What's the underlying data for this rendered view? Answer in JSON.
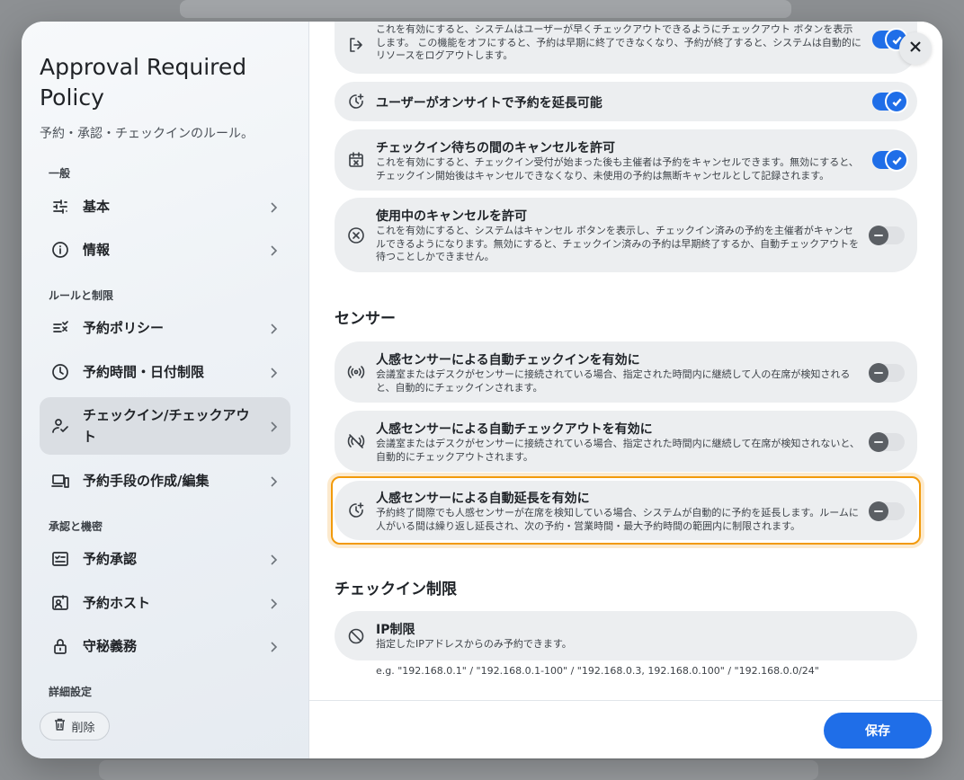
{
  "sidebar": {
    "title": "Approval Required Policy",
    "subtitle": "予約・承認・チェックインのルール。",
    "groups": {
      "general": "一般",
      "rules": "ルールと制限",
      "approval": "承認と機密",
      "advanced": "詳細設定"
    },
    "items": [
      {
        "label": "基本",
        "icon": "sliders-icon"
      },
      {
        "label": "情報",
        "icon": "info-icon"
      },
      {
        "label": "予約ポリシー",
        "icon": "list-check-icon"
      },
      {
        "label": "予約時間・日付制限",
        "icon": "clock-icon"
      },
      {
        "label": "チェックイン/チェックアウト",
        "icon": "user-check-icon",
        "active": true
      },
      {
        "label": "予約手段の作成/編集",
        "icon": "devices-icon"
      },
      {
        "label": "予約承認",
        "icon": "checklist-icon"
      },
      {
        "label": "予約ホスト",
        "icon": "id-card-icon"
      },
      {
        "label": "守秘義務",
        "icon": "lock-icon"
      }
    ],
    "delete_label": "削除"
  },
  "main": {
    "cards_top": [
      {
        "title": "",
        "desc": "これを有効にすると、システムはユーザーが早くチェックアウトできるようにチェックアウト ボタンを表示します。 この機能をオフにすると、予約は早期に終了できなくなり、予約が終了すると、システムは自動的にリソースをログアウトします。",
        "enabled": true
      },
      {
        "title": "ユーザーがオンサイトで予約を延長可能",
        "desc": "",
        "enabled": true
      },
      {
        "title": "チェックイン待ちの間のキャンセルを許可",
        "desc": "これを有効にすると、チェックイン受付が始まった後も主催者は予約をキャンセルできます。無効にすると、チェックイン開始後はキャンセルできなくなり、未使用の予約は無断キャンセルとして記録されます。",
        "enabled": true
      },
      {
        "title": "使用中のキャンセルを許可",
        "desc": "これを有効にすると、システムはキャンセル ボタンを表示し、チェックイン済みの予約を主催者がキャンセルできるようになります。無効にすると、チェックイン済みの予約は早期終了するか、自動チェックアウトを待つことしかできません。",
        "enabled": false
      }
    ],
    "sensor_heading": "センサー",
    "sensor_cards": [
      {
        "title": "人感センサーによる自動チェックインを有効に",
        "desc": "会議室またはデスクがセンサーに接続されている場合、指定された時間内に継続して人の在席が検知されると、自動的にチェックインされます。",
        "enabled": false
      },
      {
        "title": "人感センサーによる自動チェックアウトを有効に",
        "desc": "会議室またはデスクがセンサーに接続されている場合、指定された時間内に継続して在席が検知されないと、自動的にチェックアウトされます。",
        "enabled": false
      },
      {
        "title": "人感センサーによる自動延長を有効に",
        "desc": "予約終了間際でも人感センサーが在席を検知している場合、システムが自動的に予約を延長します。ルームに人がいる間は繰り返し延長され、次の予約・営業時間・最大予約時間の範囲内に制限されます。",
        "enabled": false
      }
    ],
    "checkin_heading": "チェックイン制限",
    "ip_card": {
      "title": "IP制限",
      "desc": "指定したIPアドレスからのみ予約できます。"
    },
    "ip_example": "e.g. \"192.168.0.1\" / \"192.168.0.1-100\" / \"192.168.0.3, 192.168.0.100\" / \"192.168.0.0/24\""
  },
  "footer": {
    "save_label": "保存"
  },
  "colors": {
    "accent": "#1f6ee8",
    "highlight": "#f29a0b"
  }
}
